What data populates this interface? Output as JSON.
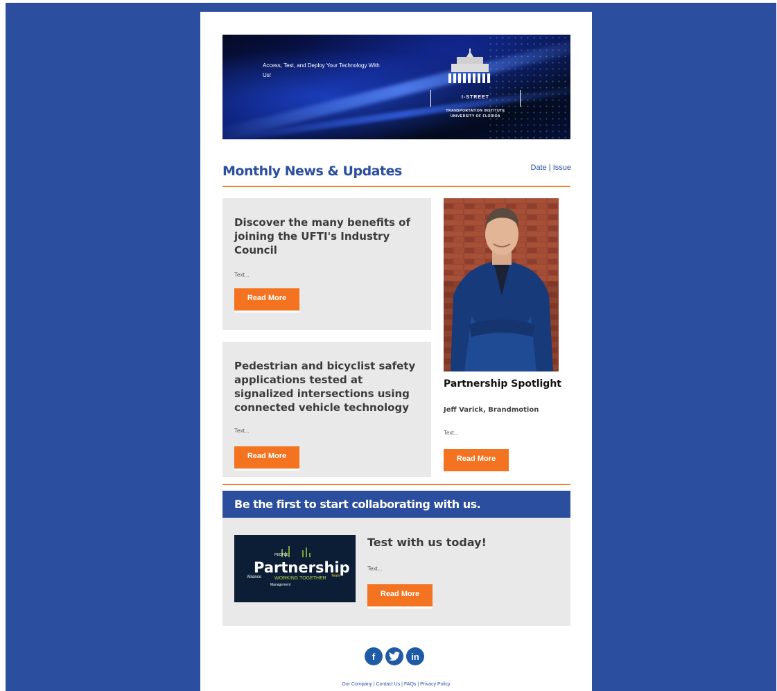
{
  "banner": {
    "tagline": "Access, Test, and Deploy Your Technology With Us!",
    "logo_name": "I-STREET",
    "logo_sub_line1": "TRANSPORTATION INSTITUTE",
    "logo_sub_line2": "UNIVERSITY OF FLORIDA"
  },
  "header": {
    "title": "Monthly News & Updates",
    "date_issue": "Date | Issue"
  },
  "articles": [
    {
      "title": "Discover the many benefits of joining the UFTI's Industry Council",
      "text": "Text...",
      "button": "Read More"
    },
    {
      "title": "Pedestrian and bicyclist safety applications tested at signalized intersections using connected vehicle technology",
      "text": "Text...",
      "button": "Read More"
    }
  ],
  "spotlight": {
    "title": "Partnership Spotlight",
    "subtitle": "Jeff Varick, Brandmotion",
    "text": "Text...",
    "button": "Read More"
  },
  "cta": {
    "bar": "Be the first to start collaborating with us.",
    "title": "Test with us today!",
    "text": "Text...",
    "button": "Read More",
    "image_word": "Partnership",
    "image_words_small": [
      "WORKING TOGETHER",
      "Alliance",
      "Team",
      "Management",
      "PEOPLE"
    ]
  },
  "social": [
    {
      "icon": "facebook-icon",
      "glyph": "f"
    },
    {
      "icon": "twitter-icon",
      "glyph": "t"
    },
    {
      "icon": "linkedin-icon",
      "glyph": "in"
    }
  ],
  "footer": {
    "links": "Our Company | Contact Us | FAQs | Privacy Policy"
  },
  "colors": {
    "brand_blue": "#2b4f9e",
    "accent_orange": "#f37321",
    "card_gray": "#e9e9e9"
  }
}
